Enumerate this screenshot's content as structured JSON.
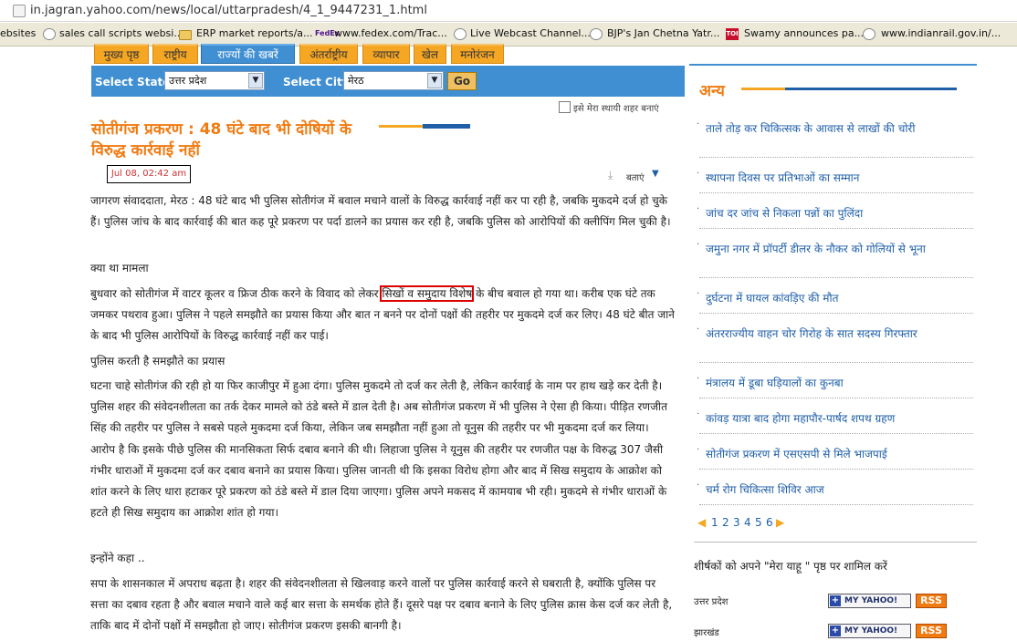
{
  "browser": {
    "url": "in.jagran.yahoo.com/news/local/uttarpradesh/4_1_9447231_1.html"
  },
  "bookmarks": [
    {
      "label": "ebsites",
      "icon": "none"
    },
    {
      "label": "sales call scripts websi...",
      "icon": "globe-icon"
    },
    {
      "label": "ERP market reports/a...",
      "icon": "folder-icon"
    },
    {
      "label": "www.fedex.com/Trac...",
      "icon": "fedex-icon"
    },
    {
      "label": "Live Webcast Channel...",
      "icon": "globe-icon"
    },
    {
      "label": "BJP's Jan Chetna Yatr...",
      "icon": "globe-icon"
    },
    {
      "label": "Swamy announces pa...",
      "icon": "toi-icon"
    },
    {
      "label": "www.indianrail.gov.in/...",
      "icon": "globe-icon"
    }
  ],
  "fedex_glyph": "FedEx",
  "toi_glyph": "TOI",
  "nav_tabs": [
    {
      "label": "मुख्य पृष्ठ",
      "active": false
    },
    {
      "label": "राष्ट्रीय",
      "active": false
    },
    {
      "label": "राज्यों की खबरें",
      "active": true
    },
    {
      "label": "अंतर्राष्ट्रीय",
      "active": false
    },
    {
      "label": "व्यापार",
      "active": false
    },
    {
      "label": "खेल",
      "active": false
    },
    {
      "label": "मनोरंजन",
      "active": false
    }
  ],
  "selectors": {
    "state_label": "Select State",
    "state_value": "उत्तर प्रदेश",
    "city_label": "Select City",
    "city_value": "मेरठ",
    "go_label": "Go"
  },
  "home_city_label": "इसे मेरा स्थायी शहर बनाएं",
  "article": {
    "title": "सोतीगंज प्रकरण : 48 घंटे बाद भी दोषियों के विरुद्ध कार्रवाई नहीं",
    "date": "Jul 08, 02:42 am",
    "tools_label": "बताएं",
    "p1": "  जागरण संवाददाता, मेरठ : 48 घंटे बाद भी पुलिस सोतीगंज में बवाल मचाने वालों के विरुद्ध कार्रवाई नहीं कर पा रही है, जबकि मुकदमे दर्ज हो चुके हैं। पुलिस जांच के बाद कार्रवाई की बात कह पूरे प्रकरण पर पर्दा डालने का प्रयास कर रही है, जबकि पुलिस को आरोपियों की क्लीपिंग मिल चुकी है।",
    "h1": "क्या था मामला",
    "p2_before": "बुधवार को सोतीगंज में वाटर कूलर व फ्रिज ठीक करने के विवाद को लेकर ",
    "p2_highlight": "सिखों व समुदाय विशेष",
    "p2_after": " के बीच बवाल हो गया था। करीब एक घंटे तक जमकर पथराव हुआ। पुलिस ने पहले समझौते का प्रयास किया और बात न बनने पर दोनों पक्षों की तहरीर पर मुकदमे दर्ज कर लिए। 48 घंटे बीत जाने के बाद भी पुलिस आरोपियों के विरुद्ध कार्रवाई नहीं कर पाई।",
    "h2": "पुलिस करती है समझौते का प्रयास",
    "p3": "घटना चाहे सोतीगंज की रही हो या फिर काजीपुर में हुआ दंगा। पुलिस मुकदमे तो दर्ज कर लेती है, लेकिन कार्रवाई के नाम पर हाथ खड़े कर देती है। पुलिस शहर की संवेदनशीलता का तर्क देकर मामले को ठंडे बस्ते में डाल देती है। अब सोतीगंज प्रकरण में भी पुलिस ने ऐसा ही किया। पीड़ित रणजीत सिंह की तहरीर पर पुलिस ने सबसे पहले मुकदमा दर्ज किया, लेकिन जब समझौता नहीं हुआ तो यूनुस की तहरीर पर भी मुकदमा दर्ज कर लिया। आरोप है कि इसके पीछे पुलिस की मानसिकता सिर्फ दबाव बनाने की थी। लिहाजा पुलिस ने यूनुस की तहरीर पर रणजीत पक्ष के विरुद्ध 307 जैसी गंभीर धाराओं में मुकदमा दर्ज कर दबाव बनाने का प्रयास किया। पुलिस जानती थी कि इसका विरोध होगा और बाद में सिख समुदाय के आक्रोश को शांत करने के लिए धारा हटाकर पूरे प्रकरण को ठंडे बस्ते में डाल दिया जाएगा। पुलिस अपने मकसद में कामयाब भी रही। मुकदमे से गंभीर धाराओं के हटते ही सिख समुदाय का आक्रोश शांत हो गया।",
    "h3": "इन्होंने कहा ..",
    "p4": "सपा के शासनकाल में अपराध बढ़ता है। शहर की संवेदनशीलता से खिलवाड़ करने वालों पर पुलिस कार्रवाई करने से घबराती है, क्योंकि पुलिस पर सत्ता का दबाव रहता है और बवाल मचाने वाले कई बार सत्ता के समर्थक होते हैं। दूसरे पक्ष पर दबाव बनाने के लिए पुलिस क्रास केस दर्ज कर लेती है, ताकि बाद में दोनों पक्षों में समझौता हो जाए। सोतीगंज प्रकरण इसकी बानगी है।"
  },
  "sidebar": {
    "heading": "अन्य",
    "items": [
      "ताले तोड़ कर चिकित्सक के आवास से लाखों की चोरी",
      "स्थापना दिवस पर प्रतिभाओं का सम्मान",
      "जांच दर जांच से निकला पन्नों का पुलिंदा",
      "जमुना नगर में प्रॉपर्टी डीलर के नौकर को गोलियों से भूना",
      "दुर्घटना में घायल कांवड़िए की मौत",
      "अंतरराज्यीय वाहन चोर गिरोह के सात सदस्य गिरफ्तार",
      "मंत्रालय में डूबा घड़ियालों का कुनबा",
      "कांवड़ यात्रा बाद होगा महापौर-पार्षद शपथ ग्रहण",
      "सोतीगंज प्रकरण में एसएसपी से मिले भाजपाई",
      "चर्म रोग चिकित्सा शिविर आज"
    ],
    "pages": [
      "1",
      "2",
      "3",
      "4",
      "5",
      "6"
    ],
    "my_yahoo_heading": "शीर्षकों को अपने \"मेरा याहू \" पृष्ठ पर शामिल करें",
    "feeds": [
      {
        "label": "उत्तर प्रदेश",
        "my_yahoo": "MY YAHOO!",
        "rss": "RSS"
      },
      {
        "label": "झारखंड",
        "my_yahoo": "MY YAHOO!",
        "rss": "RSS"
      }
    ]
  },
  "colors": {
    "accent_orange": "#f07b12",
    "accent_blue": "#3f8fd2",
    "link_blue": "#1f5fa8",
    "highlight_red": "#d00000"
  }
}
